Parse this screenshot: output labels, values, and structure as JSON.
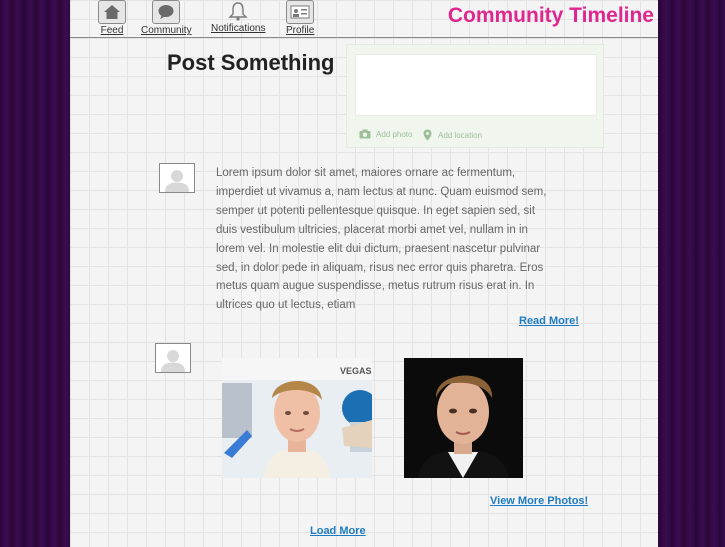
{
  "nav": {
    "items": [
      {
        "label": "Feed",
        "icon": "home-icon"
      },
      {
        "label": "Community",
        "icon": "chat-icon"
      },
      {
        "label": "Notifications",
        "icon": "bell-icon"
      },
      {
        "label": "Profile",
        "icon": "profile-card-icon"
      }
    ],
    "brand": "Community Timeline"
  },
  "composer": {
    "heading": "Post Something",
    "add_photo": "Add photo",
    "add_location": "Add location",
    "accent_color": "#9cbf9a"
  },
  "feed": {
    "posts": [
      {
        "type": "text",
        "body": "Lorem ipsum dolor sit amet, maiores ornare ac fermentum, imperdiet ut vivamus a, nam lectus at nunc. Quam euismod sem, semper ut potenti pellentesque quisque. In eget sapien sed, sit duis vestibulum ultricies, placerat morbi amet vel, nullam in in lorem vel. In molestie elit dui dictum, praesent nascetur pulvinar sed, in dolor pede in aliquam, risus nec error quis pharetra. Eros metus quam augue suspendisse, metus rutrum risus erat in.  In ultrices quo ut lectus, etiam",
        "link": "Read More!"
      },
      {
        "type": "photos",
        "photo_1_backdrop_text": "VEGAS",
        "link": "View More Photos!"
      }
    ],
    "load_more": "Load More"
  },
  "colors": {
    "brand": "#e0278f",
    "link": "#1e7bc2",
    "background": "#2a0838"
  }
}
